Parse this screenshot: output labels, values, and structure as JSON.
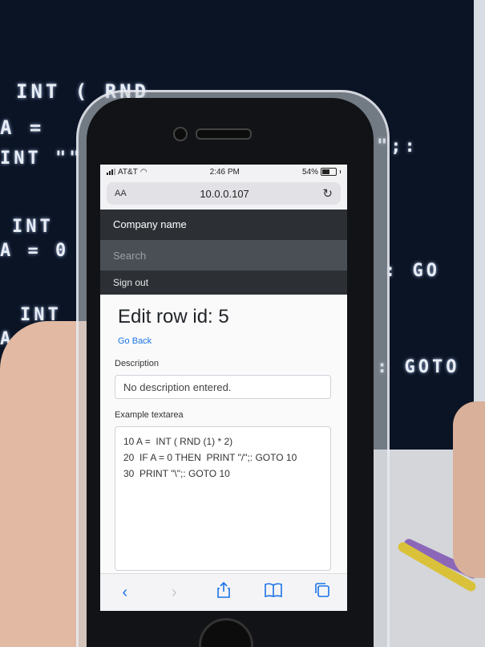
{
  "background": {
    "basic_lines": [
      "INT ( RND",
      "A = ",
      "INT \"\"",
      "INT",
      "A = 0",
      ": GO",
      "INT",
      "A =",
      ": GOTO",
      "\";:"
    ]
  },
  "status_bar": {
    "carrier": "AT&T",
    "time": "2:46 PM",
    "battery_text": "54%",
    "battery_level": 0.54
  },
  "browser": {
    "text_size_button": "AA",
    "url": "10.0.0.107",
    "reload_icon": "reload-icon"
  },
  "navbar": {
    "brand": "Company name",
    "search_placeholder": "Search",
    "sign_out": "Sign out"
  },
  "page": {
    "title": "Edit row id: 5",
    "go_back": "Go Back",
    "description_label": "Description",
    "description_placeholder": "No description entered.",
    "textarea_label": "Example textarea",
    "textarea_lines": [
      "10 A =  INT ( RND (1) * 2)",
      "20  IF A = 0 THEN  PRINT \"/\";: GOTO 10",
      "30  PRINT \"\\\";: GOTO 10"
    ]
  },
  "toolbar": {
    "back_icon": "back-chevron-icon",
    "forward_icon": "forward-chevron-icon",
    "share_icon": "share-icon",
    "bookmarks_icon": "bookmarks-icon",
    "tabs_icon": "tabs-icon"
  },
  "colors": {
    "navbar_bg": "#343a40",
    "link": "#1a73e8"
  }
}
